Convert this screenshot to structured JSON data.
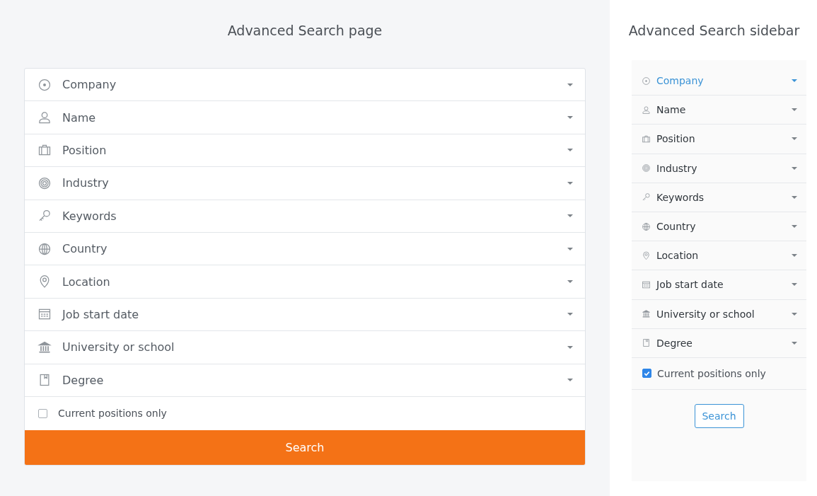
{
  "page": {
    "title": "Advanced Search page",
    "filters": [
      {
        "kind": "company",
        "label": "Company",
        "selected": false
      },
      {
        "kind": "name",
        "label": "Name",
        "selected": false
      },
      {
        "kind": "position",
        "label": "Position",
        "selected": false
      },
      {
        "kind": "industry",
        "label": "Industry",
        "selected": false
      },
      {
        "kind": "keywords",
        "label": "Keywords",
        "selected": false
      },
      {
        "kind": "country",
        "label": "Country",
        "selected": false
      },
      {
        "kind": "location",
        "label": "Location",
        "selected": false
      },
      {
        "kind": "date",
        "label": "Job start date",
        "selected": false
      },
      {
        "kind": "school",
        "label": "University or school",
        "selected": false
      },
      {
        "kind": "degree",
        "label": "Degree",
        "selected": false
      }
    ],
    "checkbox": {
      "label": "Current positions only",
      "checked": false
    },
    "button": "Search"
  },
  "sidebar": {
    "title": "Advanced Search sidebar",
    "filters": [
      {
        "kind": "company",
        "label": "Company",
        "selected": true
      },
      {
        "kind": "name",
        "label": "Name",
        "selected": false
      },
      {
        "kind": "position",
        "label": "Position",
        "selected": false
      },
      {
        "kind": "industry",
        "label": "Industry",
        "selected": false
      },
      {
        "kind": "keywords",
        "label": "Keywords",
        "selected": false
      },
      {
        "kind": "country",
        "label": "Country",
        "selected": false
      },
      {
        "kind": "location",
        "label": "Location",
        "selected": false
      },
      {
        "kind": "date",
        "label": "Job start date",
        "selected": false
      },
      {
        "kind": "school",
        "label": "University or school",
        "selected": false
      },
      {
        "kind": "degree",
        "label": "Degree",
        "selected": false
      }
    ],
    "checkbox": {
      "label": "Current positions only",
      "checked": true
    },
    "button": "Search"
  }
}
